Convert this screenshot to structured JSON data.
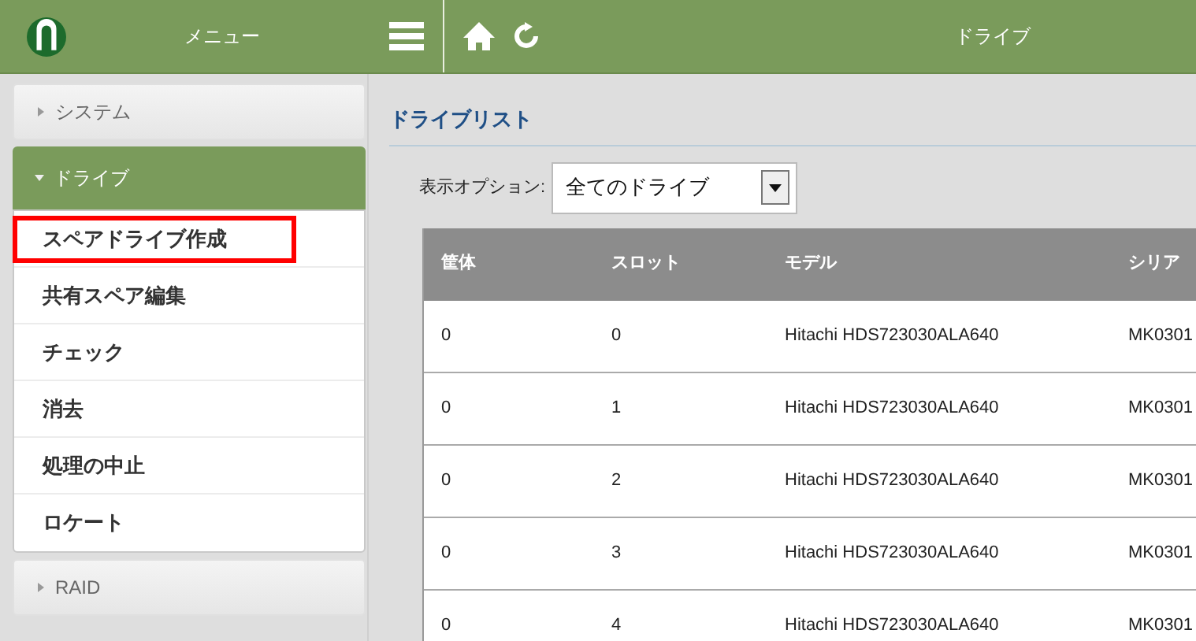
{
  "header": {
    "menu_label": "メニュー",
    "title": "ドライブ"
  },
  "sidebar": {
    "sections": [
      {
        "label": "システム",
        "expanded": false
      },
      {
        "label": "ドライブ",
        "expanded": true,
        "items": [
          {
            "label": "スペアドライブ作成",
            "highlighted": true
          },
          {
            "label": "共有スペア編集",
            "highlighted": false
          },
          {
            "label": "チェック",
            "highlighted": false
          },
          {
            "label": "消去",
            "highlighted": false
          },
          {
            "label": "処理の中止",
            "highlighted": false
          },
          {
            "label": "ロケート",
            "highlighted": false
          }
        ]
      },
      {
        "label": "RAID",
        "expanded": false
      }
    ]
  },
  "main": {
    "title": "ドライブリスト",
    "option_label": "表示オプション:",
    "option_value": "全てのドライブ",
    "table": {
      "columns": [
        "筐体",
        "スロット",
        "モデル",
        "シリア"
      ],
      "rows": [
        [
          "0",
          "0",
          "Hitachi HDS723030ALA640",
          "MK0301"
        ],
        [
          "0",
          "1",
          "Hitachi HDS723030ALA640",
          "MK0301"
        ],
        [
          "0",
          "2",
          "Hitachi HDS723030ALA640",
          "MK0301"
        ],
        [
          "0",
          "3",
          "Hitachi HDS723030ALA640",
          "MK0301"
        ],
        [
          "0",
          "4",
          "Hitachi HDS723030ALA640",
          "MK0301"
        ]
      ]
    }
  }
}
